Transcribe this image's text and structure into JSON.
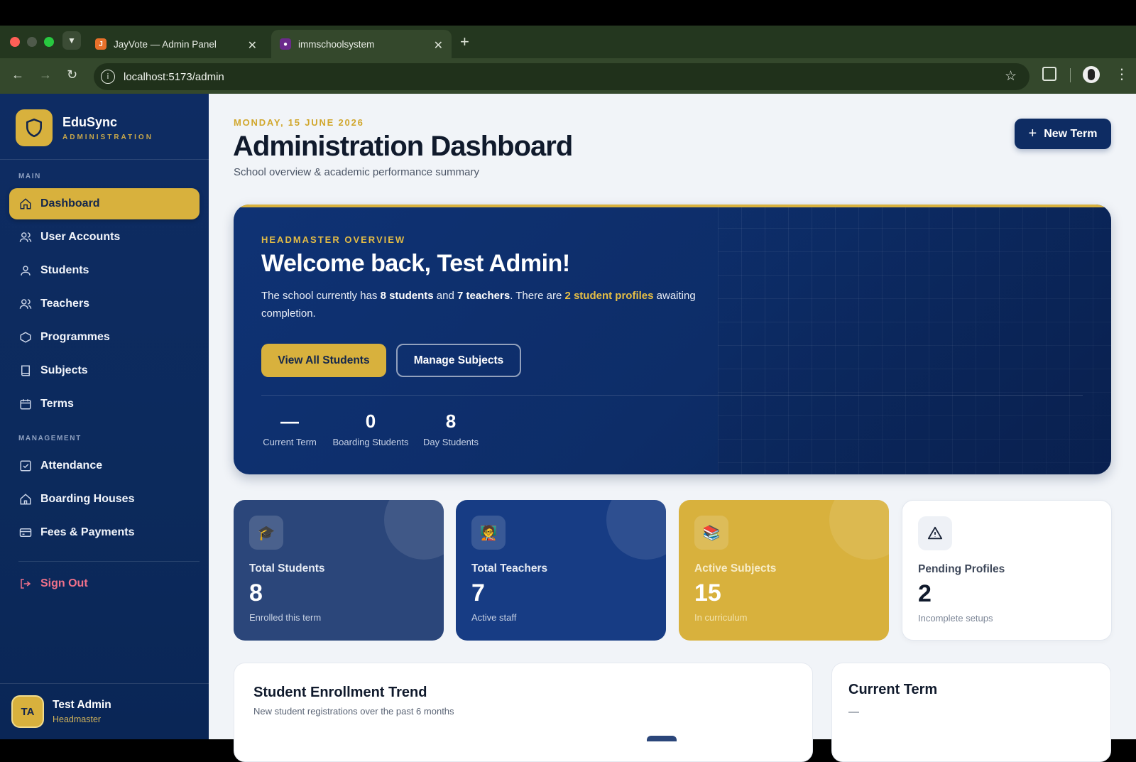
{
  "browser": {
    "tabs": [
      {
        "title": "JayVote — Admin Panel",
        "active": false
      },
      {
        "title": "immschoolsystem",
        "active": true
      }
    ],
    "url": "localhost:5173/admin"
  },
  "sidebar": {
    "brand_name": "EduSync",
    "brand_sub": "ADMINISTRATION",
    "section_main": "MAIN",
    "section_management": "MANAGEMENT",
    "items": [
      {
        "label": "Dashboard",
        "icon": "home-icon",
        "active": true
      },
      {
        "label": "User Accounts",
        "icon": "users-icon"
      },
      {
        "label": "Students",
        "icon": "user-icon"
      },
      {
        "label": "Teachers",
        "icon": "users-icon"
      },
      {
        "label": "Programmes",
        "icon": "graduation-icon"
      },
      {
        "label": "Subjects",
        "icon": "book-icon"
      },
      {
        "label": "Terms",
        "icon": "calendar-icon"
      }
    ],
    "management_items": [
      {
        "label": "Attendance",
        "icon": "check-square-icon"
      },
      {
        "label": "Boarding Houses",
        "icon": "house-icon"
      },
      {
        "label": "Fees & Payments",
        "icon": "credit-card-icon"
      }
    ],
    "sign_out": "Sign Out",
    "user": {
      "initials": "TA",
      "name": "Test Admin",
      "role": "Headmaster"
    }
  },
  "header": {
    "date": "MONDAY, 15 JUNE 2026",
    "title": "Administration Dashboard",
    "subtitle": "School overview & academic performance summary",
    "new_term_label": "New Term"
  },
  "hero": {
    "eyebrow": "HEADMASTER OVERVIEW",
    "title": "Welcome back, Test Admin!",
    "desc_1": "The school currently has ",
    "students_count": "8 students",
    "desc_2": " and ",
    "teachers_count": "7 teachers",
    "desc_3": ". There are ",
    "pending_profiles": "2 student profiles",
    "desc_4": " awaiting completion.",
    "btn_primary": "View All Students",
    "btn_secondary": "Manage Subjects",
    "stats": [
      {
        "value": "—",
        "label": "Current Term"
      },
      {
        "value": "0",
        "label": "Boarding Students"
      },
      {
        "value": "8",
        "label": "Day Students"
      }
    ]
  },
  "cards": [
    {
      "label": "Total Students",
      "value": "8",
      "sub": "Enrolled this term",
      "icon": "graduation-cap-icon",
      "color": "#2b467a"
    },
    {
      "label": "Total Teachers",
      "value": "7",
      "sub": "Active staff",
      "icon": "teacher-icon",
      "color": "#173c84"
    },
    {
      "label": "Active Subjects",
      "value": "15",
      "sub": "In curriculum",
      "icon": "books-icon",
      "color": "#d8b13d"
    },
    {
      "label": "Pending Profiles",
      "value": "2",
      "sub": "Incomplete setups",
      "icon": "warning-icon",
      "color": "#ffffff"
    }
  ],
  "panels": {
    "enrollment_title": "Student Enrollment Trend",
    "enrollment_sub": "New student registrations over the past 6 months",
    "current_term_title": "Current Term",
    "current_term_value": "—"
  }
}
